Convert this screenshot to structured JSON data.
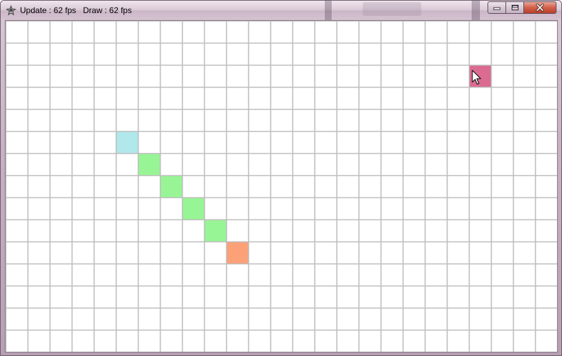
{
  "window": {
    "title": "Update : 62 fps   Draw : 62 fps",
    "minimize_icon": "minimize-icon",
    "maximize_icon": "maximize-icon",
    "close_icon": "close-icon"
  },
  "grid": {
    "columns": 25,
    "rows": 15,
    "line_color": "#bdbdbd",
    "background": "#ffffff"
  },
  "cells": [
    {
      "role": "snake-head",
      "col": 5,
      "row": 5,
      "color": "#b0e8ec"
    },
    {
      "role": "snake-body",
      "col": 6,
      "row": 6,
      "color": "#98f595"
    },
    {
      "role": "snake-body",
      "col": 7,
      "row": 7,
      "color": "#98f595"
    },
    {
      "role": "snake-body",
      "col": 8,
      "row": 8,
      "color": "#98f595"
    },
    {
      "role": "snake-body",
      "col": 9,
      "row": 9,
      "color": "#98f595"
    },
    {
      "role": "snake-tail",
      "col": 10,
      "row": 10,
      "color": "#fca077"
    },
    {
      "role": "food",
      "col": 21,
      "row": 2,
      "color": "#db6b90"
    }
  ],
  "cursor": {
    "icon": "mouse-pointer-icon",
    "col": 21,
    "row": 2
  }
}
